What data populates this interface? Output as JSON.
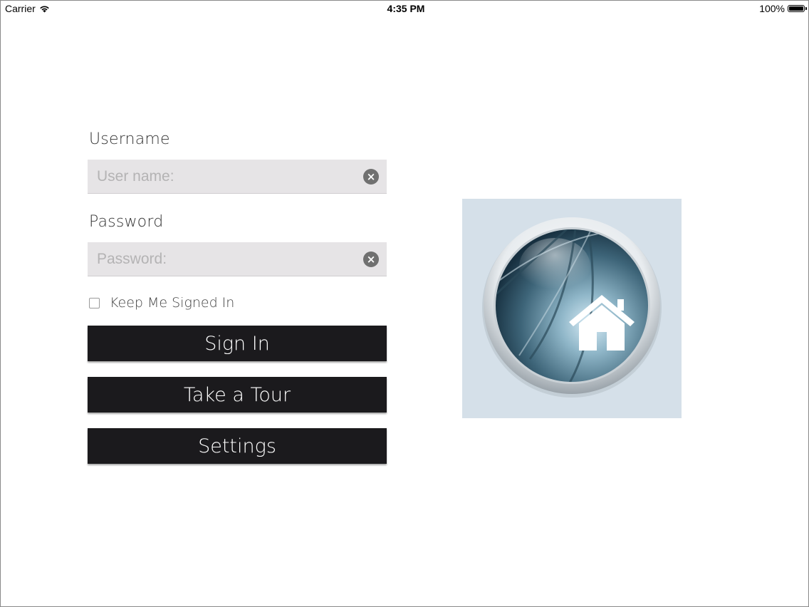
{
  "status_bar": {
    "carrier": "Carrier",
    "time": "4:35 PM",
    "battery": "100%"
  },
  "form": {
    "username_label": "Username",
    "username_placeholder": "User name:",
    "password_label": "Password",
    "password_placeholder": "Password:",
    "keep_signed_in_label": "Keep Me Signed In",
    "keep_signed_in_checked": false
  },
  "buttons": {
    "sign_in": "Sign In",
    "take_tour": "Take a Tour",
    "settings": "Settings"
  },
  "icons": {
    "wifi": "wifi-icon",
    "battery": "battery-icon",
    "clear": "clear-icon",
    "logo": "home-globe-logo"
  },
  "colors": {
    "button_bg": "#1b1a1d",
    "field_bg": "#e6e4e6",
    "logo_bg": "#d5e0e9"
  }
}
